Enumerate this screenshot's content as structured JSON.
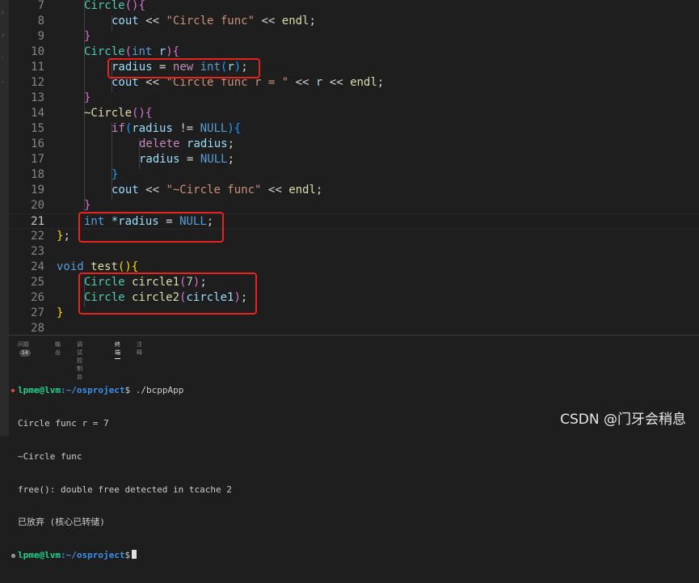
{
  "code_lines": [
    {
      "n": "7"
    },
    {
      "n": "8"
    },
    {
      "n": "9"
    },
    {
      "n": "10"
    },
    {
      "n": "11"
    },
    {
      "n": "12"
    },
    {
      "n": "13"
    },
    {
      "n": "14"
    },
    {
      "n": "15"
    },
    {
      "n": "16"
    },
    {
      "n": "17"
    },
    {
      "n": "18"
    },
    {
      "n": "19"
    },
    {
      "n": "20"
    },
    {
      "n": "21"
    },
    {
      "n": "22"
    },
    {
      "n": "23"
    },
    {
      "n": "24"
    },
    {
      "n": "25"
    },
    {
      "n": "26"
    },
    {
      "n": "27"
    },
    {
      "n": "28"
    }
  ],
  "tokens": {
    "Circle": "Circle",
    "cout": "cout",
    "lt": "<<",
    "endl": "endl",
    "semi": ";",
    "str_circle_func": "\"Circle func\"",
    "str_circle_func_r": "\"Circle func r = \"",
    "str_dtor": "\"~Circle func\"",
    "int": "int",
    "r": "r",
    "radius": "radius",
    "eq": "=",
    "new": "new",
    "if": "if",
    "neq": "!=",
    "NULL": "NULL",
    "delete": "delete",
    "dtor": "~Circle",
    "star_radius": "*radius",
    "void": "void",
    "test": "test",
    "circle1": "circle1",
    "circle2": "circle2",
    "seven": "7",
    "lp": "(",
    "rp": ")",
    "lb": "{",
    "rb": "}",
    "rb_semi": "};"
  },
  "panel": {
    "tabs": [
      {
        "label": "问题",
        "badge": "14"
      },
      {
        "label": "输出"
      },
      {
        "label": "调试控制台"
      },
      {
        "label": "终端",
        "active": true
      },
      {
        "label": "注释"
      }
    ]
  },
  "terminal": {
    "prompt_user": "lpme@lvm",
    "prompt_path": ":~/osproject",
    "prompt_sign": "$",
    "cmd1": " ./bcppApp",
    "out1": "Circle func r = 7",
    "out2": "~Circle func",
    "out3": "free(): double free detected in tcache 2",
    "out4": "已放弃 (核心已转储)"
  },
  "watermark": "CSDN @门牙会稍息",
  "colors": {
    "highlight_box": "#e8231f",
    "editor_bg": "#1e1e1e"
  }
}
